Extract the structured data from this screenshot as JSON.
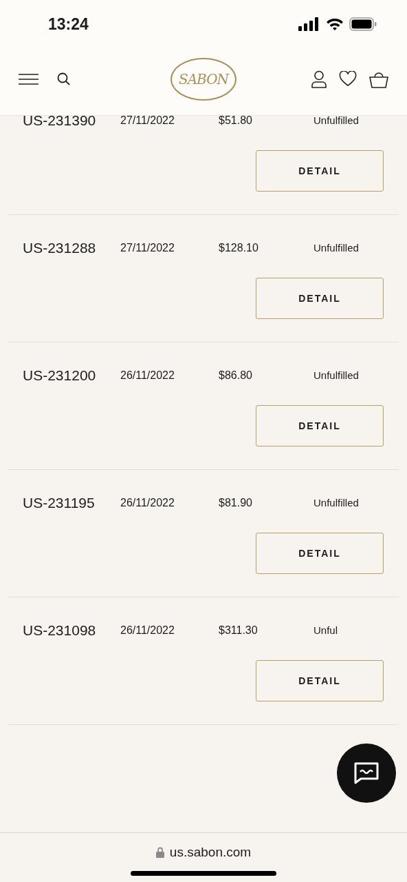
{
  "status_bar": {
    "time": "13:24"
  },
  "header": {
    "logo": "SABON"
  },
  "orders": [
    {
      "id": "US-231390",
      "date": "27/11/2022",
      "total": "$51.80",
      "status": "Unfulfilled",
      "button": "DETAIL"
    },
    {
      "id": "US-231288",
      "date": "27/11/2022",
      "total": "$128.10",
      "status": "Unfulfilled",
      "button": "DETAIL"
    },
    {
      "id": "US-231200",
      "date": "26/11/2022",
      "total": "$86.80",
      "status": "Unfulfilled",
      "button": "DETAIL"
    },
    {
      "id": "US-231195",
      "date": "26/11/2022",
      "total": "$81.90",
      "status": "Unfulfilled",
      "button": "DETAIL"
    },
    {
      "id": "US-231098",
      "date": "26/11/2022",
      "total": "$311.30",
      "status": "Unful",
      "button": "DETAIL"
    }
  ],
  "browser": {
    "url": "us.sabon.com"
  }
}
